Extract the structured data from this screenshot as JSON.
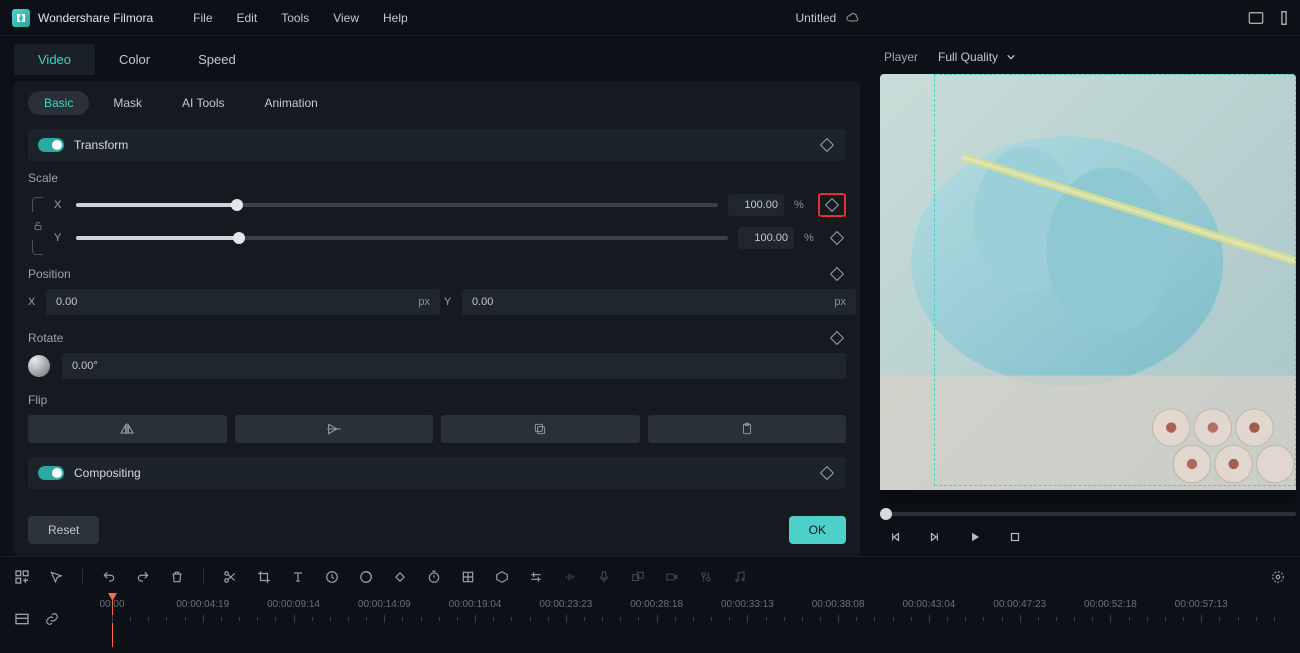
{
  "app": {
    "name": "Wondershare Filmora",
    "project": "Untitled"
  },
  "menu": {
    "file": "File",
    "edit": "Edit",
    "tools": "Tools",
    "view": "View",
    "help": "Help"
  },
  "inspector": {
    "top_tabs": {
      "video": "Video",
      "color": "Color",
      "speed": "Speed"
    },
    "sub_tabs": {
      "basic": "Basic",
      "mask": "Mask",
      "ai": "AI Tools",
      "anim": "Animation"
    },
    "transform": {
      "title": "Transform",
      "scale_label": "Scale",
      "scale_x_axis": "X",
      "scale_y_axis": "Y",
      "scale_x_value": "100.00",
      "scale_y_value": "100.00",
      "percent": "%",
      "position_label": "Position",
      "pos_x_axis": "X",
      "pos_y_axis": "Y",
      "pos_x_value": "0.00",
      "pos_y_value": "0.00",
      "px": "px",
      "rotate_label": "Rotate",
      "rotate_value": "0.00°",
      "flip_label": "Flip"
    },
    "compositing": {
      "title": "Compositing"
    },
    "buttons": {
      "reset": "Reset",
      "ok": "OK"
    }
  },
  "player": {
    "label": "Player",
    "quality": "Full Quality"
  },
  "timeline": {
    "labels": [
      "00:00",
      "00:00:04:19",
      "00:00:09:14",
      "00:00:14:09",
      "00:00:19:04",
      "00:00:23:23",
      "00:00:28:18",
      "00:00:33:13",
      "00:00:38:08",
      "00:00:43:04",
      "00:00:47:23",
      "00:00:52:18",
      "00:00:57:13"
    ]
  }
}
